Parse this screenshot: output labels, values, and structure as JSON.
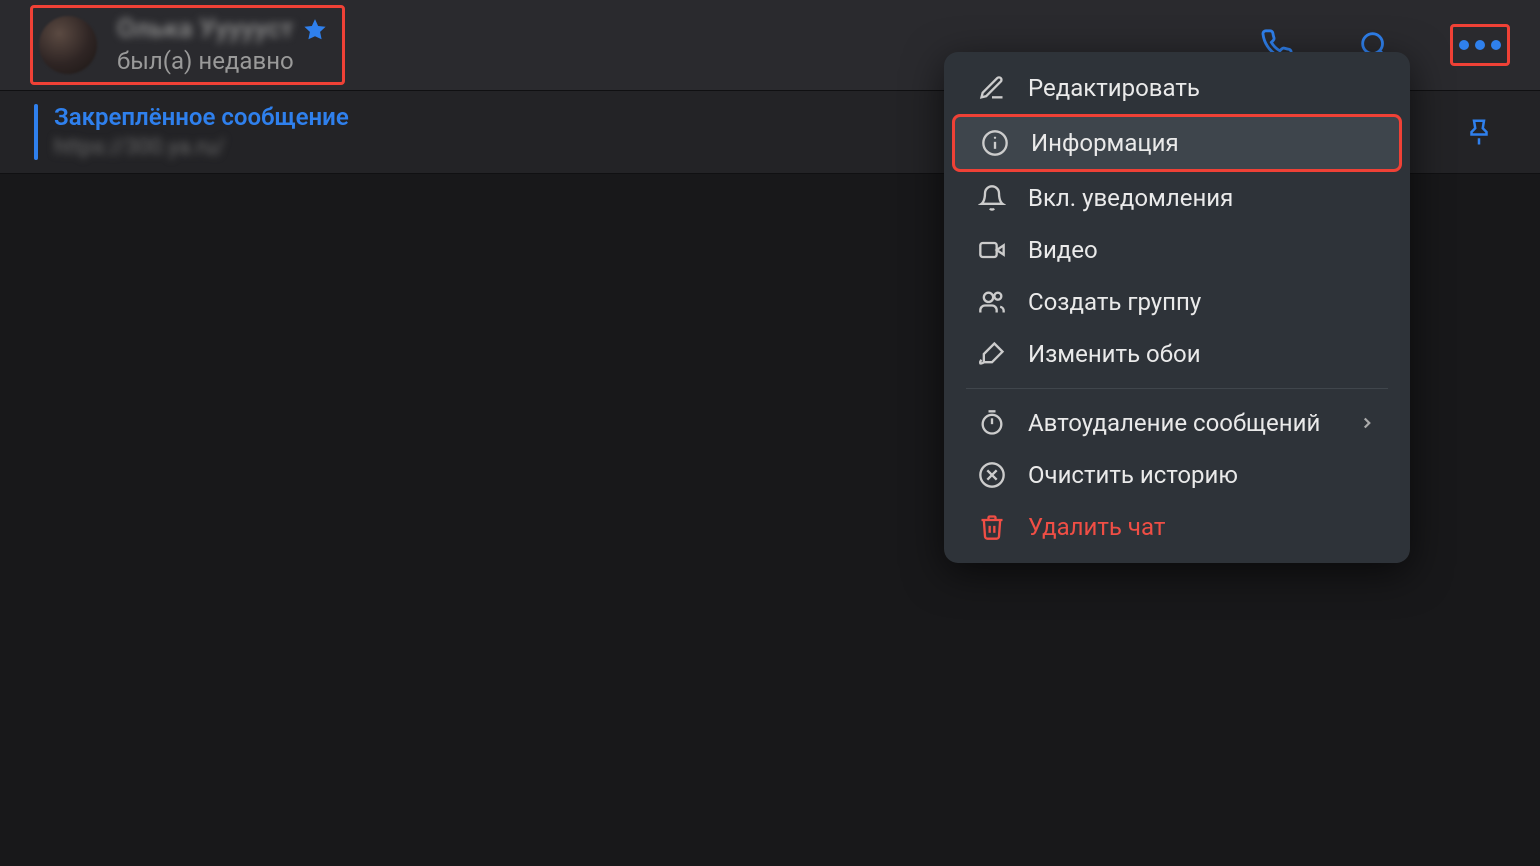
{
  "header": {
    "profile_name": "Олька Уууууст",
    "profile_status": "был(а) недавно"
  },
  "pinned": {
    "title": "Закреплённое сообщение",
    "subtitle": "https://300.ya.ru/"
  },
  "menu": {
    "edit": "Редактировать",
    "info": "Информация",
    "notifications": "Вкл. уведомления",
    "video": "Видео",
    "create_group": "Создать группу",
    "change_wallpaper": "Изменить обои",
    "auto_delete": "Автоудаление сообщений",
    "clear_history": "Очистить историю",
    "delete_chat": "Удалить чат"
  },
  "colors": {
    "accent": "#2f80ed",
    "highlight": "#ef4136",
    "danger": "#f04e45"
  }
}
